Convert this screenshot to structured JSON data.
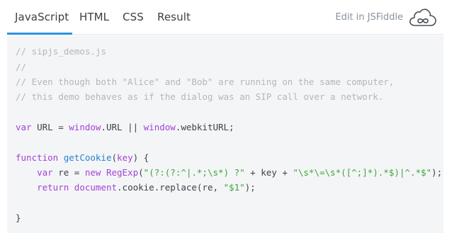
{
  "tabs": [
    {
      "label": "JavaScript"
    },
    {
      "label": "HTML"
    },
    {
      "label": "CSS"
    },
    {
      "label": "Result"
    }
  ],
  "active_tab": "JavaScript",
  "edit_link": "Edit in JSFiddle",
  "code": {
    "l1": "// sipjs_demos.js",
    "l2": "//",
    "l3": "// Even though both \"Alice\" and \"Bob\" are running on the same computer,",
    "l4": "// this demo behaves as if the dialog was an SIP call over a network.",
    "l5": {
      "kw": "var",
      "a": " URL = ",
      "b": "window",
      "c": ".URL || ",
      "d": "window",
      "e": ".webkitURL;"
    },
    "l6": {
      "kw": "function",
      "sp": " ",
      "name": "getCookie",
      "open": "(",
      "param": "key",
      "close": ") {"
    },
    "l7": {
      "indent": "    ",
      "kw": "var",
      "a": " re = ",
      "new": "new",
      "sp": " ",
      "cls": "RegExp",
      "open": "(",
      "s1": "\"(?:(?:^|.*;\\s*) ?\"",
      "mid": " + key + ",
      "s2": "\"\\s*\\=\\s*([^;]*).*$)|^.*$\"",
      "end": ");"
    },
    "l8": {
      "indent": "    ",
      "kw": "return",
      "sp": " ",
      "doc": "document",
      "a": ".cookie.replace(re, ",
      "s": "\"$1\"",
      "end": ");"
    },
    "l9": "}"
  },
  "colors": {
    "accent": "#2a94e0",
    "keyword": "#a343d6",
    "function": "#2a7fd4",
    "string": "#3da63a",
    "comment": "#b2b7bd",
    "code_bg": "#f4f5f7"
  },
  "icons": {
    "jsfiddle": "cloud-infinity-icon"
  }
}
